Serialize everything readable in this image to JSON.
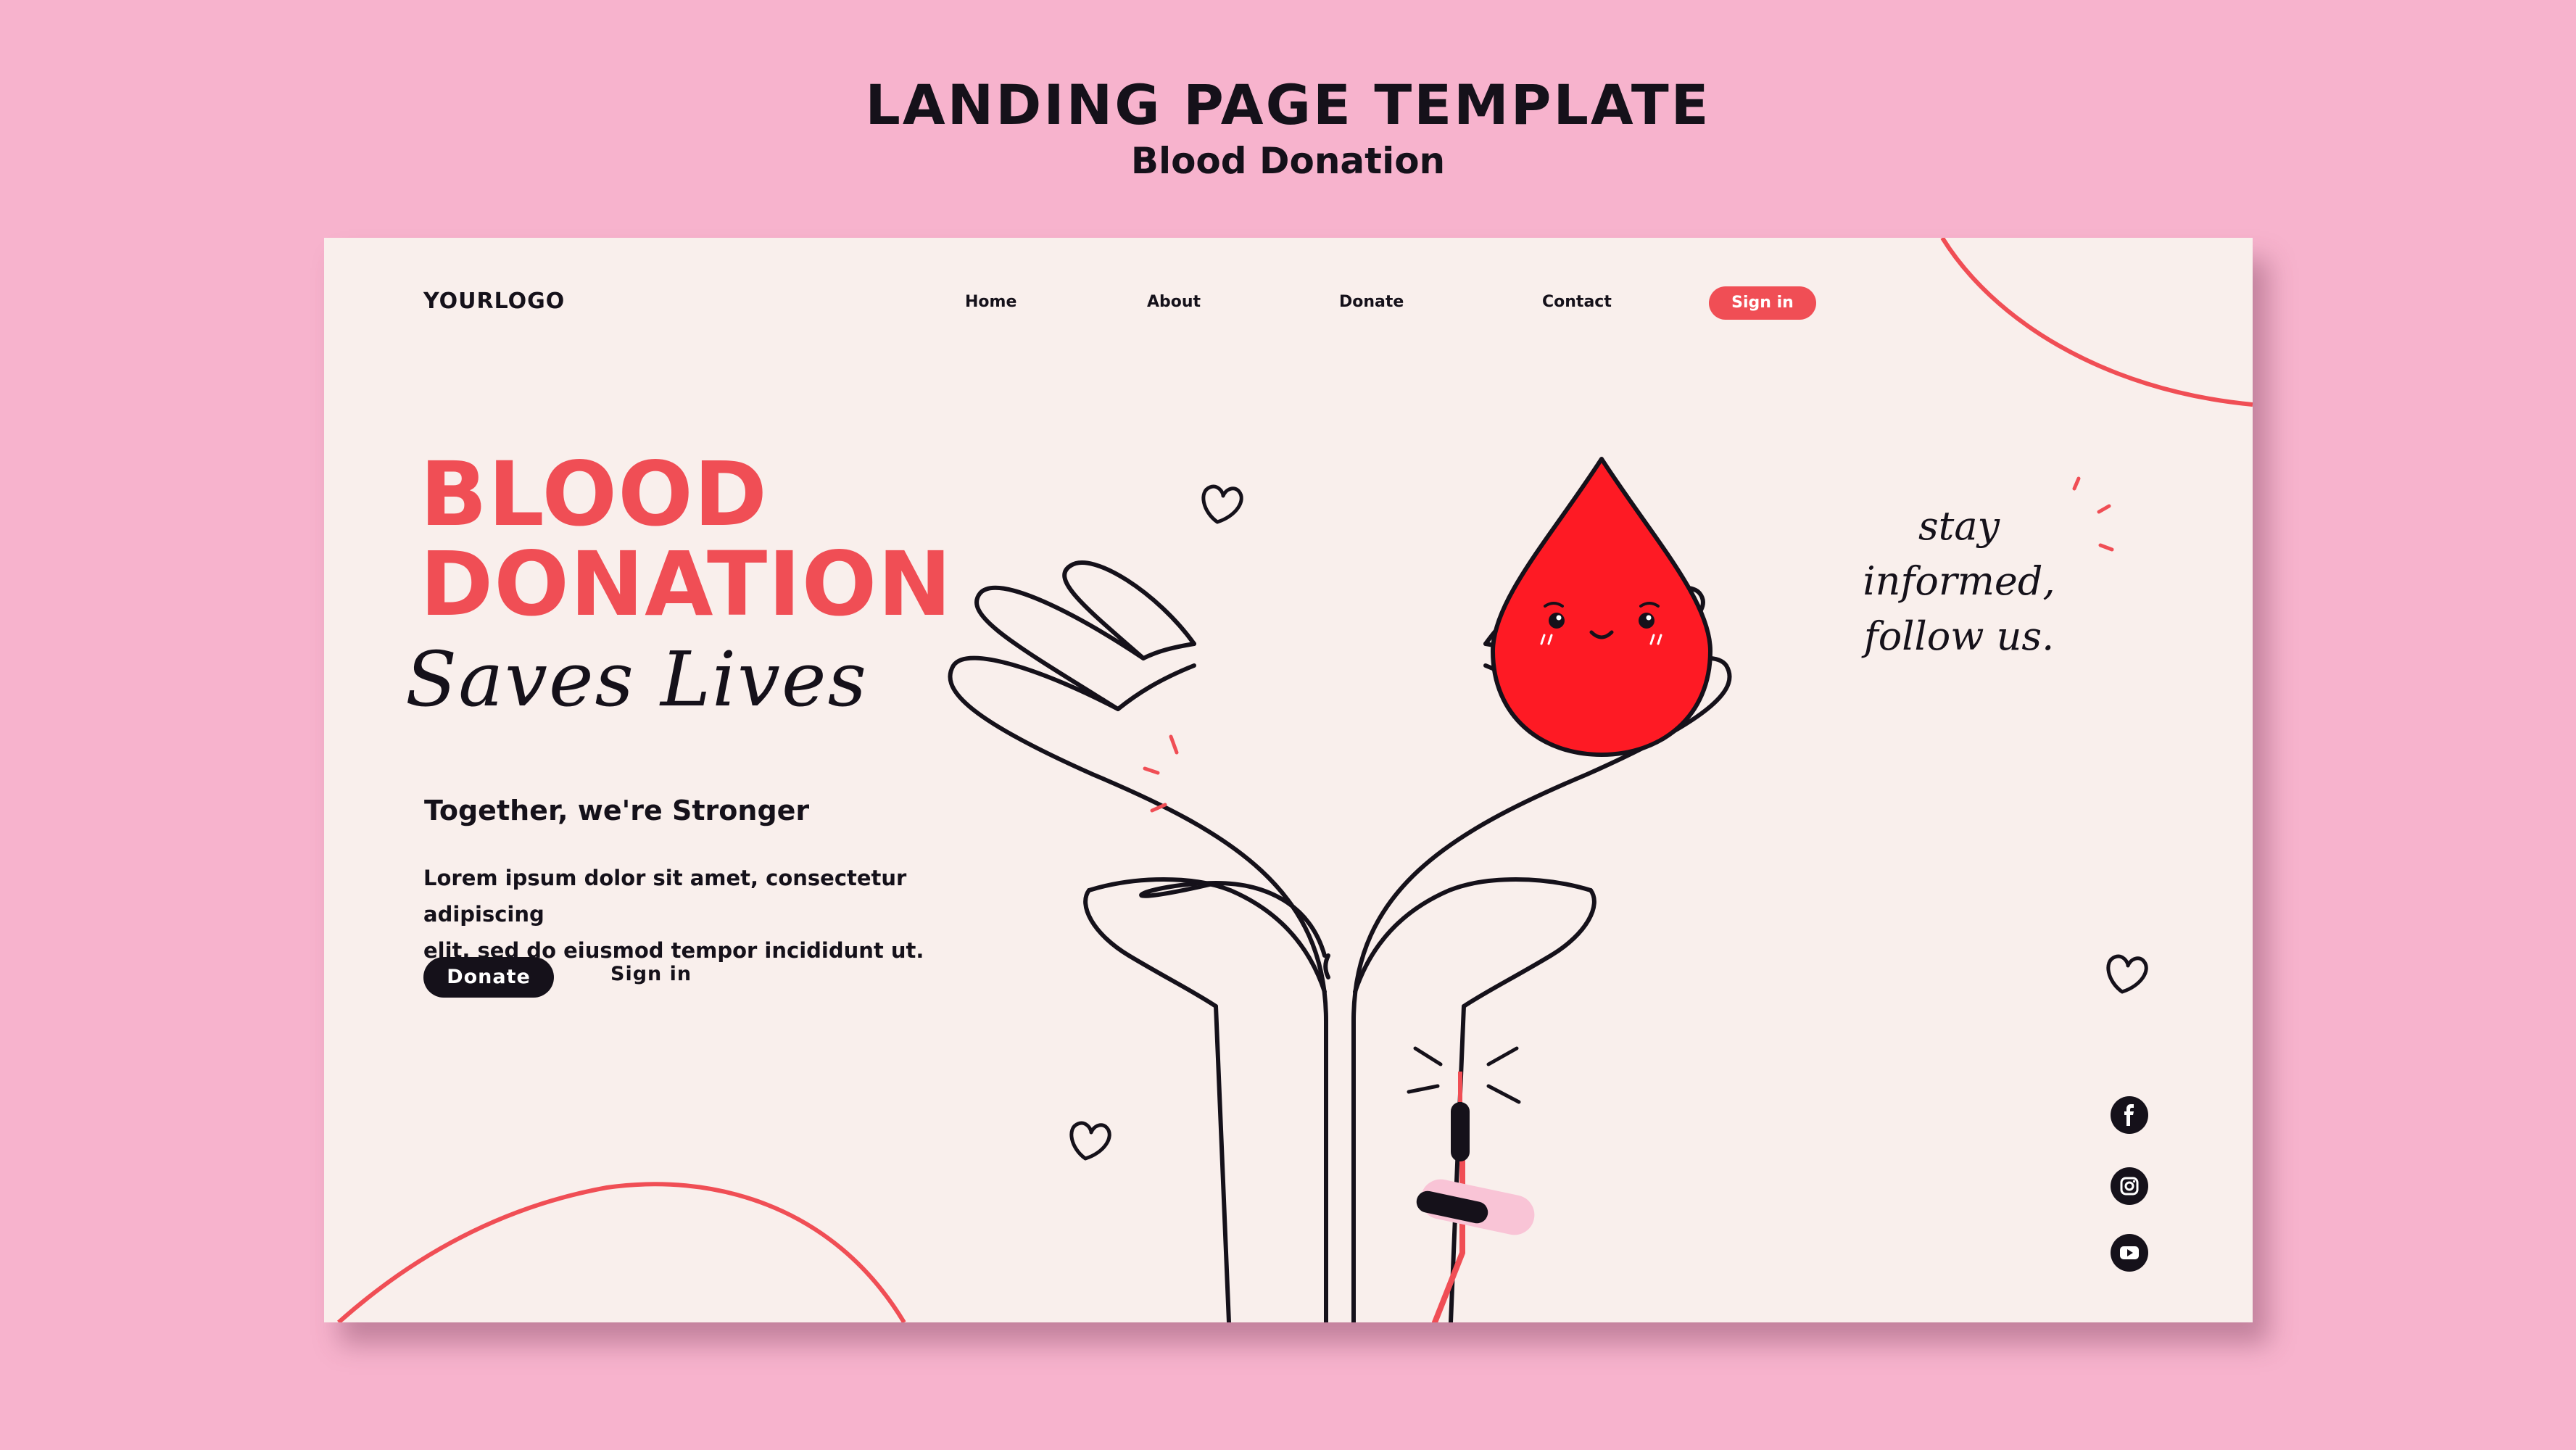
{
  "header": {
    "title": "LANDING PAGE TEMPLATE",
    "subtitle": "Blood Donation"
  },
  "nav": {
    "logo": "YOURLOGO",
    "items": [
      {
        "label": "Home"
      },
      {
        "label": "About"
      },
      {
        "label": "Donate"
      },
      {
        "label": "Contact"
      }
    ],
    "signin_label": "Sign in"
  },
  "hero": {
    "title_line1": "BLOOD",
    "title_line2": "DONATION",
    "script": "Saves Lives",
    "tagline": "Together, we're Stronger",
    "body_line1": "Lorem ipsum dolor sit amet, consectetur adipiscing",
    "body_line2": "elit, sed do eiusmod tempor incididunt ut.",
    "donate_label": "Donate",
    "signin_label": "Sign in"
  },
  "follow": {
    "line1": "stay informed,",
    "line2": "follow us."
  },
  "social": [
    {
      "icon": "facebook-icon"
    },
    {
      "icon": "instagram-icon"
    },
    {
      "icon": "youtube-icon"
    }
  ],
  "colors": {
    "background": "#f7b3cd",
    "card": "#f9efec",
    "accent": "#f04e55",
    "drop": "#fe1a24",
    "ink": "#15111a"
  }
}
